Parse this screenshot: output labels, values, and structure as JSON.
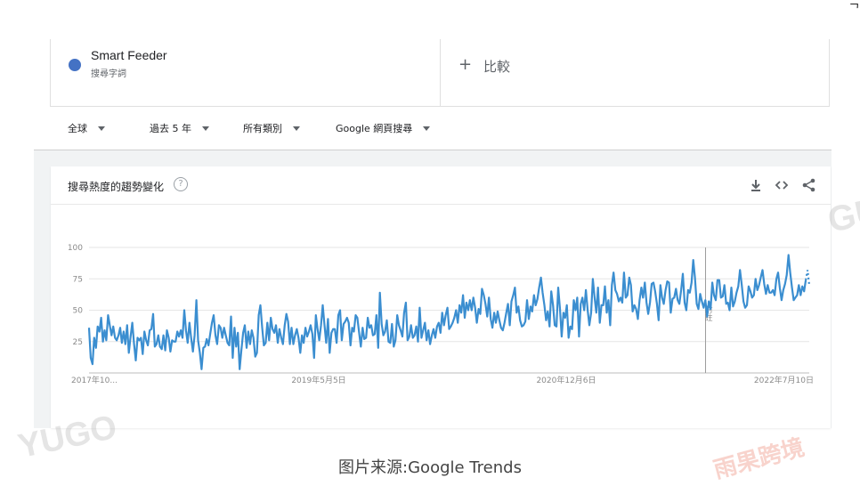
{
  "corner_mark": "ᄀ",
  "term": {
    "name": "Smart Feeder",
    "type": "搜尋字詞",
    "color": "#4472c4"
  },
  "compare": {
    "plus": "+",
    "label": "比較"
  },
  "filters": [
    {
      "label": "全球"
    },
    {
      "label": "過去 5 年"
    },
    {
      "label": "所有類別"
    },
    {
      "label": "Google 網頁搜尋"
    }
  ],
  "card": {
    "title": "搜尋熱度的趨勢變化",
    "help_icon": "help-icon",
    "tools": [
      "download-icon",
      "embed-icon",
      "share-icon"
    ]
  },
  "chart_data": {
    "type": "line",
    "title": "",
    "xlabel": "",
    "ylabel": "",
    "ylim": [
      0,
      100
    ],
    "yticks": [
      25,
      50,
      75,
      100
    ],
    "xticks": [
      "2017年10...",
      "2019年5月5日",
      "2020年12月6日",
      "2022年7月10日"
    ],
    "marker_label": "附註",
    "color": "#3b8ed0",
    "series": [
      {
        "values": [
          36,
          12,
          7,
          28,
          20,
          37,
          33,
          44,
          25,
          34,
          26,
          46,
          38,
          30,
          37,
          28,
          26,
          30,
          36,
          24,
          33,
          23,
          38,
          16,
          29,
          40,
          23,
          10,
          28,
          26,
          28,
          15,
          33,
          26,
          22,
          34,
          35,
          47,
          21,
          23,
          30,
          21,
          19,
          30,
          18,
          34,
          28,
          17,
          26,
          25,
          25,
          33,
          29,
          34,
          28,
          50,
          34,
          24,
          40,
          28,
          17,
          30,
          58,
          26,
          16,
          3,
          20,
          21,
          27,
          22,
          31,
          40,
          46,
          30,
          23,
          38,
          36,
          28,
          36,
          30,
          24,
          22,
          45,
          12,
          36,
          21,
          32,
          3,
          18,
          32,
          38,
          20,
          33,
          23,
          34,
          28,
          13,
          16,
          46,
          54,
          36,
          22,
          24,
          40,
          26,
          44,
          35,
          32,
          38,
          24,
          35,
          28,
          23,
          38,
          47,
          41,
          23,
          36,
          23,
          30,
          35,
          28,
          16,
          30,
          24,
          36,
          29,
          33,
          38,
          31,
          12,
          46,
          35,
          26,
          38,
          54,
          38,
          24,
          43,
          16,
          32,
          35,
          35,
          24,
          46,
          50,
          26,
          39,
          41,
          44,
          40,
          22,
          36,
          33,
          46,
          44,
          32,
          21,
          36,
          27,
          28,
          44,
          36,
          38,
          30,
          31,
          46,
          20,
          64,
          39,
          30,
          33,
          42,
          25,
          24,
          39,
          21,
          26,
          46,
          38,
          34,
          29,
          48,
          56,
          26,
          29,
          38,
          28,
          30,
          37,
          25,
          52,
          28,
          34,
          40,
          26,
          34,
          23,
          30,
          35,
          28,
          37,
          40,
          32,
          48,
          38,
          46,
          52,
          35,
          37,
          40,
          44,
          50,
          40,
          54,
          48,
          62,
          44,
          56,
          50,
          58,
          50,
          60,
          52,
          40,
          51,
          47,
          67,
          62,
          55,
          45,
          60,
          43,
          36,
          48,
          40,
          49,
          42,
          36,
          34,
          40,
          48,
          55,
          38,
          57,
          62,
          68,
          48,
          53,
          42,
          37,
          38,
          41,
          58,
          43,
          53,
          49,
          62,
          54,
          59,
          68,
          76,
          64,
          54,
          42,
          49,
          37,
          65,
          54,
          38,
          37,
          68,
          51,
          29,
          48,
          44,
          54,
          28,
          37,
          35,
          58,
          50,
          60,
          29,
          55,
          60,
          50,
          66,
          50,
          38,
          48,
          75,
          60,
          48,
          68,
          40,
          54,
          54,
          69,
          48,
          58,
          38,
          70,
          80,
          66,
          63,
          57,
          60,
          56,
          80,
          60,
          62,
          76,
          70,
          49,
          54,
          51,
          43,
          58,
          68,
          60,
          72,
          56,
          47,
          56,
          71,
          72,
          65,
          55,
          42,
          70,
          60,
          55,
          66,
          73,
          72,
          48,
          59,
          60,
          67,
          58,
          55,
          66,
          79,
          56,
          50,
          66,
          64,
          72,
          90,
          76,
          55,
          51,
          63,
          57,
          52,
          58,
          45,
          57,
          51,
          72,
          62,
          58,
          74,
          74,
          60,
          61,
          70,
          55,
          56,
          50,
          68,
          53,
          57,
          64,
          69,
          82,
          70,
          57,
          52,
          54,
          69,
          65,
          60,
          62,
          75,
          66,
          70,
          76,
          82,
          71,
          63,
          70,
          64,
          64,
          66,
          62,
          75,
          80,
          68,
          58,
          66,
          71,
          78,
          94,
          80,
          68,
          58,
          60,
          62,
          70,
          62,
          69,
          65,
          74,
          82,
          70
        ]
      }
    ]
  },
  "caption": "图片来源:Google Trends",
  "watermarks": [
    "YUGO",
    "GU",
    "雨果跨境"
  ]
}
